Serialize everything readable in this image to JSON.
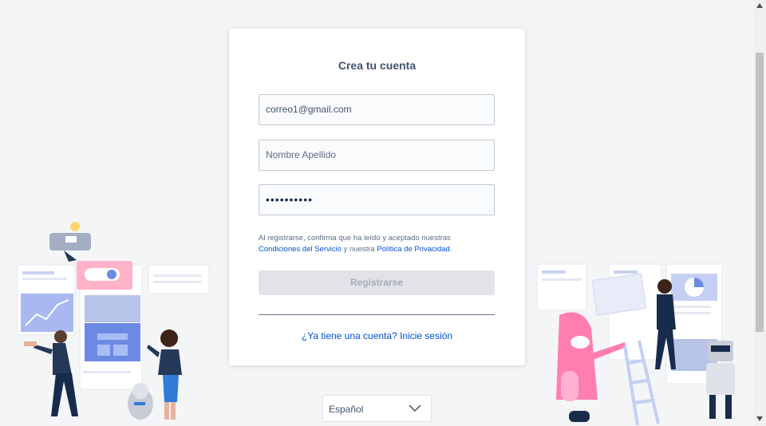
{
  "signup": {
    "title": "Crea tu cuenta",
    "email_value": "correo1@gmail.com",
    "name_placeholder": "Nombre Apellido",
    "password_value": "••••••••••",
    "legal_prefix": "Al registrarse, confirma que ha leído y aceptado nuestras",
    "terms_link": "Condiciones del Servicio",
    "legal_middle": "y nuestra",
    "privacy_link": "Política de Privacidad",
    "legal_suffix": ".",
    "submit_label": "Registrarse",
    "login_link": "¿Ya tiene una cuenta? Inicie sesión"
  },
  "language": {
    "selected": "Español"
  },
  "icons": {
    "dropdown": "chevron-down-icon",
    "scroll_up": "scroll-up-arrow-icon",
    "scroll_down": "scroll-down-arrow-icon"
  },
  "colors": {
    "link": "#0052cc",
    "button_disabled_bg": "#e2e3e6",
    "button_disabled_text": "#a5adba",
    "page_bg": "#f4f5f7"
  }
}
